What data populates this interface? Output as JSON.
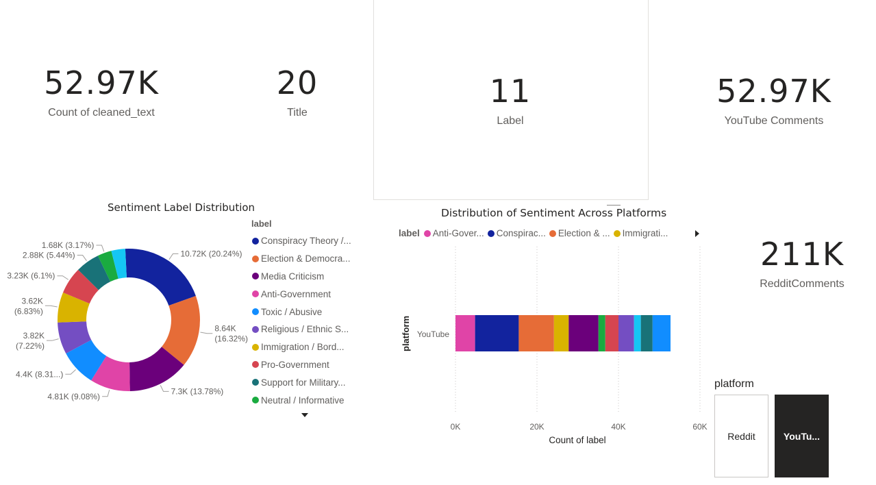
{
  "kpis": {
    "count_cleaned_text": {
      "value": "52.97K",
      "label": "Count of cleaned_text"
    },
    "title": {
      "value": "20",
      "label": "Title"
    },
    "label": {
      "value": "11",
      "label": "Label"
    },
    "youtube_comments": {
      "value": "52.97K",
      "label": "YouTube Comments"
    },
    "reddit_comments": {
      "value": "211K",
      "label": "RedditComments"
    }
  },
  "donut": {
    "title": "Sentiment Label Distribution",
    "legend_title": "label",
    "legend_items": [
      "Conspiracy Theory /...",
      "Election & Democra...",
      "Media Criticism",
      "Anti-Government",
      "Toxic / Abusive",
      "Religious / Ethnic S...",
      "Immigration / Bord...",
      "Pro-Government",
      "Support for Military...",
      "Neutral / Informative"
    ]
  },
  "bar": {
    "title": "Distribution of Sentiment Across Platforms",
    "legend_title": "label",
    "legend_items": [
      "Anti-Gover...",
      "Conspirac...",
      "Election & ...",
      "Immigrati..."
    ],
    "xlabel": "Count of label",
    "ylabel": "platform",
    "category": "YouTube",
    "ticks": [
      "0K",
      "20K",
      "40K",
      "60K"
    ]
  },
  "slicer": {
    "title": "platform",
    "options": [
      "Reddit",
      "YouTu..."
    ],
    "selected": "YouTu..."
  },
  "colors": {
    "conspiracy": "#12239e",
    "election": "#e66c37",
    "media": "#6b007b",
    "anti_gov": "#e044a7",
    "toxic": "#118dff",
    "religious": "#744ec2",
    "immigration": "#d9b300",
    "pro_gov": "#d64550",
    "military": "#197278",
    "neutral": "#1aab40",
    "other": "#15c6f4"
  },
  "chart_data": [
    {
      "type": "pie",
      "title": "Sentiment Label Distribution",
      "slices": [
        {
          "name": "Conspiracy Theory /...",
          "value": 10720,
          "label": "10.72K (20.24%)",
          "color": "#12239e"
        },
        {
          "name": "Election & Democra...",
          "value": 8640,
          "label": "8.64K (16.32%)",
          "color": "#e66c37"
        },
        {
          "name": "Media Criticism",
          "value": 7300,
          "label": "7.3K (13.78%)",
          "color": "#6b007b"
        },
        {
          "name": "Anti-Government",
          "value": 4810,
          "label": "4.81K (9.08%)",
          "color": "#e044a7"
        },
        {
          "name": "Toxic / Abusive",
          "value": 4400,
          "label": "4.4K (8.31...)",
          "color": "#118dff"
        },
        {
          "name": "Religious / Ethnic S...",
          "value": 3820,
          "label": "3.82K (7.22%)",
          "color": "#744ec2"
        },
        {
          "name": "Immigration / Bord...",
          "value": 3620,
          "label": "3.62K (6.83%)",
          "color": "#d9b300"
        },
        {
          "name": "Pro-Government",
          "value": 3230,
          "label": "3.23K (6.1%)",
          "color": "#d64550"
        },
        {
          "name": "Support for Military...",
          "value": 2880,
          "label": "2.88K (5.44%)",
          "color": "#197278"
        },
        {
          "name": "Neutral / Informative",
          "value": 1680,
          "label": "1.68K (3.17%)",
          "color": "#1aab40"
        },
        {
          "name": "",
          "value": 1670,
          "label": "",
          "color": "#15c6f4"
        }
      ]
    },
    {
      "type": "bar",
      "orientation": "horizontal",
      "stacked": true,
      "title": "Distribution of Sentiment Across Platforms",
      "categories": [
        "YouTube"
      ],
      "xlabel": "Count of label",
      "ylabel": "platform",
      "xlim": [
        0,
        60000
      ],
      "series": [
        {
          "values": [
            4810
          ],
          "color": "#e044a7"
        },
        {
          "values": [
            10720
          ],
          "color": "#12239e"
        },
        {
          "values": [
            8640
          ],
          "color": "#e66c37"
        },
        {
          "values": [
            3620
          ],
          "color": "#d9b300"
        },
        {
          "values": [
            7300
          ],
          "color": "#6b007b"
        },
        {
          "values": [
            1680
          ],
          "color": "#1aab40"
        },
        {
          "values": [
            3230
          ],
          "color": "#d64550"
        },
        {
          "values": [
            3820
          ],
          "color": "#744ec2"
        },
        {
          "values": [
            1670
          ],
          "color": "#15c6f4"
        },
        {
          "values": [
            2880
          ],
          "color": "#197278"
        },
        {
          "values": [
            4400
          ],
          "color": "#118dff"
        }
      ]
    }
  ]
}
